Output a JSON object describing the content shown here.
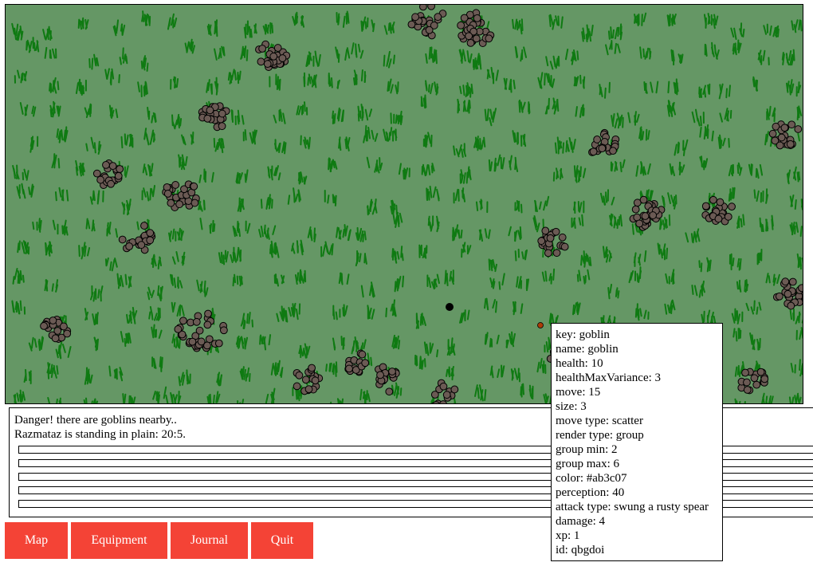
{
  "colors": {
    "plain": "#659765",
    "grass": "#0f7a12",
    "goblin": "#6b5a54",
    "player": "#000000",
    "marker": "#ab3c07",
    "button": "#f44336"
  },
  "messages": [
    "Danger! there are goblins nearby..",
    "Razmataz is standing in plain: 20:5."
  ],
  "buttons": {
    "map": "Map",
    "equipment": "Equipment",
    "journal": "Journal",
    "quit": "Quit"
  },
  "tooltip": [
    "key: goblin",
    "name: goblin",
    "health: 10",
    "healthMaxVariance: 3",
    "move: 15",
    "size: 3",
    "move type: scatter",
    "render type: group",
    "group min: 2",
    "group max: 6",
    "color: #ab3c07",
    "perception: 40",
    "attack type: swung a rusty spear",
    "damage: 4",
    "xp: 1",
    "id: qbgdoi"
  ]
}
